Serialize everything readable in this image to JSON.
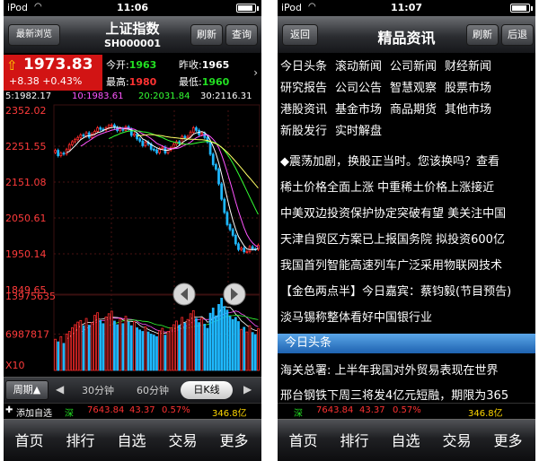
{
  "left": {
    "status": {
      "carrier": "iPod",
      "time": "11:06"
    },
    "nav": {
      "back": "最新浏览",
      "title": "上证指数",
      "code": "SH000001",
      "refresh": "刷新",
      "query": "查询"
    },
    "quote": {
      "price": "1973.83",
      "change": "+8.38 +0.43%",
      "open_label": "今开:",
      "open": "1963",
      "prev_label": "昨收:",
      "prev": "1965",
      "high_label": "最高:",
      "high": "1980",
      "low_label": "最低:",
      "low": "1960"
    },
    "ma": {
      "ma5": "5:1982.17",
      "ma10": "10:1983.61",
      "ma20": "20:2031.84",
      "ma30": "30:2116.31"
    },
    "price_ticks": [
      "2352.02",
      "2251.55",
      "2151.08",
      "2050.61",
      "1950.14",
      "1849.65"
    ],
    "volume_ticks": {
      "max": "13975635",
      "mid": "6987817",
      "unit": "X10"
    },
    "period": {
      "button": "周期▲",
      "left_arrow": "◀",
      "min30": "30分钟",
      "min60": "60分钟",
      "day_k": "日K线",
      "right_arrow": "▶"
    },
    "index_strip": {
      "add": "添加自选",
      "market": "深",
      "value": "7643.84",
      "change": "43.37",
      "percent": "0.57%",
      "amount": "346.8亿"
    },
    "tabs": [
      "首页",
      "排行",
      "自选",
      "交易",
      "更多"
    ]
  },
  "right": {
    "status": {
      "carrier": "iPod",
      "time": "11:07"
    },
    "nav": {
      "back": "返回",
      "title": "精品资讯",
      "refresh": "刷新",
      "back2": "后退"
    },
    "categories": [
      [
        "今日头条",
        "滚动新闻",
        "公司新闻",
        "财经新闻"
      ],
      [
        "研究报告",
        "公司公告",
        "智慧观察",
        "股票市场"
      ],
      [
        "港股资讯",
        "基金市场",
        "商品期货",
        "其他市场"
      ],
      [
        "新股发行",
        "实时解盘"
      ]
    ],
    "headlines": [
      "◆震荡加剧，换股正当时。您该换吗？查看",
      "稀土价格全面上涨 中重稀土价格上涨接近",
      "中美双边投资保护协定突破有望 美关注中国",
      "天津自贸区方案已上报国务院 拟投资600亿",
      "我国首列智能高速列车广泛采用物联网技术",
      "【金色两点半】今日嘉宾：蔡钧毅(节目预告)",
      "淡马锡称整体看好中国银行业"
    ],
    "section_title": "今日头条",
    "headlines2": [
      "海关总署: 上半年我国对外贸易表现在世界",
      "邢台钢铁下周三将发4亿元短融，期限为365"
    ],
    "index_strip": {
      "market": "深",
      "value": "7643.84",
      "change": "43.37",
      "percent": "0.57%",
      "amount": "346.8亿"
    },
    "tabs": [
      "首页",
      "排行",
      "自选",
      "交易",
      "更多"
    ]
  },
  "chart_data": {
    "type": "candlestick",
    "ylim": [
      1849.65,
      2352.02
    ],
    "close": [
      2240,
      2225,
      2232,
      2230,
      2242,
      2256,
      2264,
      2270,
      2276,
      2283,
      2280,
      2289,
      2276,
      2286,
      2293,
      2303,
      2299,
      2297,
      2303,
      2309,
      2311,
      2304,
      2295,
      2301,
      2296,
      2306,
      2299,
      2282,
      2286,
      2272,
      2266,
      2253,
      2263,
      2257,
      2243,
      2241,
      2233,
      2245,
      2249,
      2233,
      2241,
      2247,
      2257,
      2264,
      2259,
      2279,
      2275,
      2279,
      2291,
      2303,
      2296,
      2284,
      2288,
      2276,
      2263,
      2229,
      2200,
      2187,
      2146,
      2103,
      2066,
      2032,
      2018,
      2002,
      1978,
      1962,
      1966,
      1956,
      1956,
      1970,
      1964,
      1963,
      1974
    ],
    "bullish": [
      true,
      false,
      true,
      false,
      true,
      true,
      true,
      true,
      true,
      true,
      false,
      true,
      false,
      true,
      true,
      true,
      false,
      false,
      true,
      true,
      true,
      false,
      false,
      true,
      false,
      true,
      false,
      false,
      true,
      false,
      false,
      false,
      true,
      false,
      false,
      false,
      false,
      true,
      true,
      false,
      true,
      true,
      true,
      true,
      false,
      true,
      false,
      true,
      true,
      true,
      false,
      false,
      true,
      false,
      false,
      false,
      false,
      false,
      false,
      false,
      false,
      false,
      false,
      false,
      false,
      false,
      true,
      false,
      true,
      true,
      false,
      false,
      true
    ],
    "ma_series": [
      "MA5",
      "MA10",
      "MA20",
      "MA30"
    ],
    "volume": [
      6000000,
      5500000,
      6500000,
      5200000,
      7000000,
      7500000,
      8200000,
      8800000,
      9300000,
      9600000,
      8600000,
      10000000,
      8700000,
      9200000,
      10600000,
      11100000,
      9600000,
      9000000,
      10300000,
      10900000,
      11400000,
      9500000,
      8800000,
      9900000,
      9000000,
      10400000,
      9300000,
      8600000,
      9400000,
      8200000,
      7800000,
      7500000,
      8400000,
      7400000,
      7000000,
      6800000,
      6500000,
      7600000,
      8100000,
      6800000,
      7500000,
      8200000,
      8800000,
      9500000,
      8700000,
      10200000,
      9100000,
      9800000,
      10900000,
      11500000,
      10000000,
      9200000,
      10100000,
      8900000,
      8100000,
      11000000,
      12000000,
      10500000,
      12700000,
      13900000,
      12300000,
      11600000,
      10400000,
      9800000,
      10200000,
      9400000,
      7900000,
      8300000,
      7400000,
      8600000,
      7300000,
      6900000,
      8000000
    ],
    "volume_max": 13975635
  }
}
